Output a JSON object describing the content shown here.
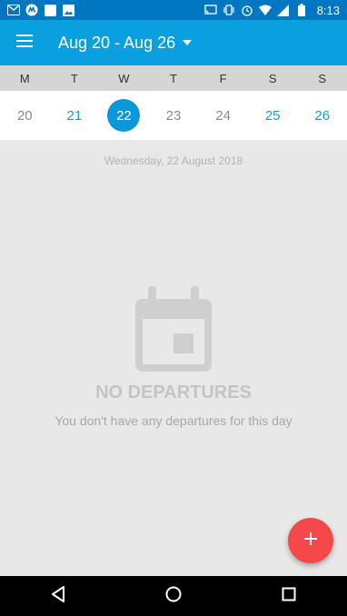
{
  "status_bar": {
    "time": "8:13",
    "left_icons": [
      "gmail-icon",
      "app-m-icon",
      "square-app-icon",
      "image-icon"
    ],
    "right_icons": [
      "cast-icon",
      "vibrate-icon",
      "alarm-icon",
      "wifi-icon",
      "signal-icon",
      "battery-icon"
    ]
  },
  "app_bar": {
    "title": "Aug 20 - Aug 26",
    "color": "#0aa0e0"
  },
  "week": {
    "days": [
      "M",
      "T",
      "W",
      "T",
      "F",
      "S",
      "S"
    ],
    "dates": [
      {
        "num": "20",
        "state": "gray"
      },
      {
        "num": "21",
        "state": "blue"
      },
      {
        "num": "22",
        "state": "selected"
      },
      {
        "num": "23",
        "state": "gray"
      },
      {
        "num": "24",
        "state": "gray"
      },
      {
        "num": "25",
        "state": "blue"
      },
      {
        "num": "26",
        "state": "blue"
      }
    ]
  },
  "selected_date_label": "Wednesday, 22 August 2018",
  "empty_state": {
    "title": "NO DEPARTURES",
    "subtitle": "You don't have any departures for this day",
    "icon": "calendar-icon"
  },
  "fab": {
    "icon": "plus-icon",
    "color": "#f5484a"
  },
  "nav_bar": {
    "icons": [
      "back-icon",
      "home-icon",
      "recents-icon"
    ]
  }
}
